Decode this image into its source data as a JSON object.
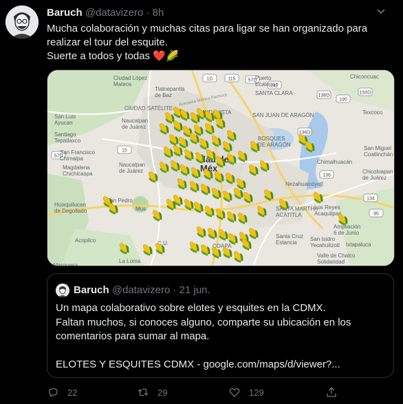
{
  "tweet": {
    "name": "Baruch",
    "handle": "@datavizero",
    "separator": "·",
    "time": "8h",
    "text": "Mucha colaboración y muchas citas para ligar se han organizado para\nrealizar el tour del esquite.\nSuerte a todos y todas",
    "heart_emoji": "❤️",
    "corn_emoji": "🌽"
  },
  "map": {
    "labels": {
      "ciudad_lopez_mateos": "Ciudad López\nMateos",
      "tlalnepantla": "Tlalnepantla\nde Baz",
      "ciudad_satelite": "CIUDAD SATÉLITE",
      "lindavista": "LINDAVISTA",
      "san_luis_ayucan": "San Luis\nAyucan",
      "santiago_tepatlaxco": "Santiago\nTepatlaxco",
      "naucalpan1": "Naucalpan\nde Juárez",
      "san_francisco_chimalpa": "San Francisco\nChimalpa",
      "magdalena_chichicaspa": "Magdalena\nChichicaspa",
      "naucalpan2": "Naucalpan\nde Juárez",
      "huixquilucan": "Huixquilucan\nde Degollado",
      "san_pedro": "San Pedro",
      "museo": "Mus",
      "acopilco": "Acopilco",
      "la_marquesa": "a Marquesa",
      "la_loma": "La Loma",
      "cu": "C.U.",
      "coapa": "COAPA",
      "ciudad_mexico": "dad de\nMéx",
      "puerto_ecatepec": "Puerto\nEcatepec",
      "santa_clara": "SANTA CLARA",
      "san_juan_aragon": "SAN JUAN DE ARAGÓN",
      "bosques_aragon": "BOSQUES\nDE ARAGÓN",
      "chiconcuac": "Chiconcuac",
      "texcoco": "Texcoco",
      "san_miguel_coatlinchan": "San Miguel\nCoatlinchán",
      "chimalhuacan": "Chimalhuacán",
      "chicoloapan": "Chicoloapan\nde Juárez",
      "nezahualcoyotl": "Nezahualcóyotl",
      "santa_martha": "SANTA MARTHA\nACATITLA",
      "los_reyes": "Los Reyes\nAcaquilpan",
      "ampliacion_6_junio": "Ampliación\n6 de Junio",
      "santa_cruz_estancia": "Santa Cruz\nEstancia",
      "san_isidro": "San Isidro\nYecahuitzotl",
      "ixtapaluca": "Ixtapaluca",
      "valle_de_chalco": "Valle de Chalco\nSolidaridad",
      "autopista": "Autopista México-Pachuca"
    },
    "road_shields": [
      "57D",
      "1D",
      "57D",
      "136D",
      "136",
      "150D",
      "190",
      "142",
      "15",
      "134",
      "95",
      "115",
      "136D"
    ]
  },
  "quote": {
    "name": "Baruch",
    "handle": "@datavizero",
    "separator": "·",
    "date": "21 jun.",
    "text": "Un mapa colaborativo sobre elotes y esquites en la CDMX.\nFaltan muchos, si conoces alguno, comparte su ubicación en los\ncomentarios para sumar al mapa.\n\nELOTES Y ESQUITES CDMX - google.com/maps/d/viewer?..."
  },
  "actions": {
    "replies": "22",
    "retweets": "29",
    "likes": "129"
  },
  "icons": {
    "reply": "reply-icon",
    "retweet": "retweet-icon",
    "like": "heart-icon",
    "share": "share-icon",
    "caret": "chevron-down-icon"
  },
  "colors": {
    "background": "#000000",
    "text": "#e7e9ea",
    "muted": "#71767b",
    "border": "#2f3336",
    "heart": "#e0245e",
    "corn_yellow": "#f4c20d",
    "corn_green": "#5ca32c"
  }
}
